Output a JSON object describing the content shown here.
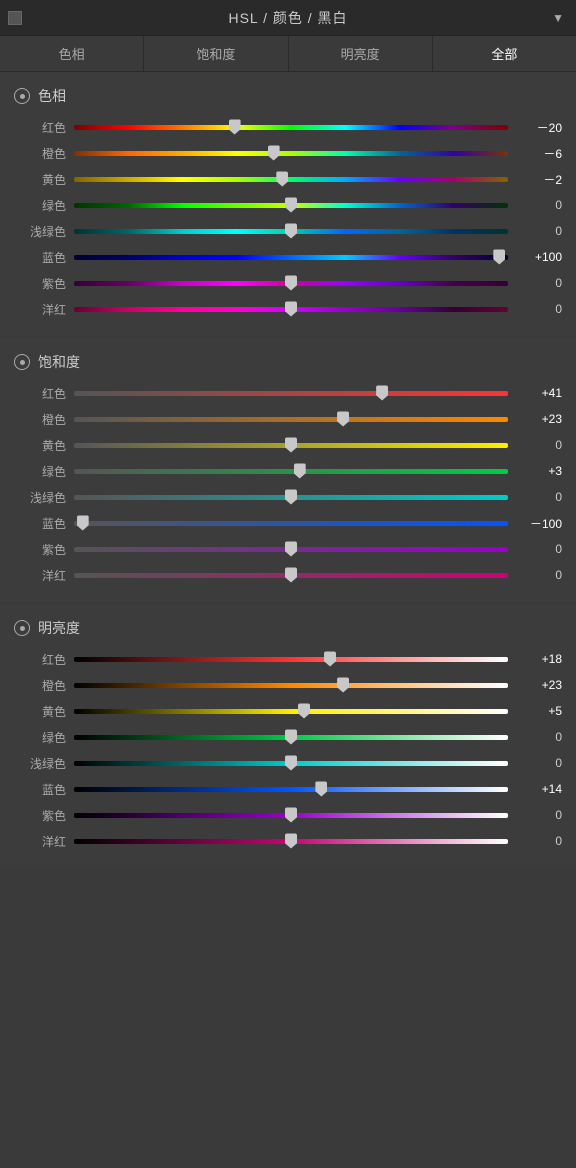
{
  "titleBar": {
    "title": "HSL / 颜色 / 黑白",
    "arrowLabel": "▼"
  },
  "tabs": [
    {
      "id": "hue",
      "label": "色相",
      "active": false
    },
    {
      "id": "saturation",
      "label": "饱和度",
      "active": false
    },
    {
      "id": "luminance",
      "label": "明亮度",
      "active": false
    },
    {
      "id": "all",
      "label": "全部",
      "active": true
    }
  ],
  "sections": [
    {
      "id": "hue",
      "title": "色相",
      "sliders": [
        {
          "label": "红色",
          "gradient": "hue-red",
          "value": -20,
          "displayValue": "－20",
          "thumbPct": 37
        },
        {
          "label": "橙色",
          "gradient": "hue-orange",
          "value": -6,
          "displayValue": "－6",
          "thumbPct": 46
        },
        {
          "label": "黄色",
          "gradient": "hue-yellow",
          "value": -2,
          "displayValue": "－2",
          "thumbPct": 48
        },
        {
          "label": "绿色",
          "gradient": "hue-green",
          "value": 0,
          "displayValue": "0",
          "thumbPct": 50
        },
        {
          "label": "浅绿色",
          "gradient": "hue-aqua",
          "value": 0,
          "displayValue": "0",
          "thumbPct": 50
        },
        {
          "label": "蓝色",
          "gradient": "hue-blue",
          "value": 100,
          "displayValue": "+100",
          "thumbPct": 98
        },
        {
          "label": "紫色",
          "gradient": "hue-purple",
          "value": 0,
          "displayValue": "0",
          "thumbPct": 50
        },
        {
          "label": "洋红",
          "gradient": "hue-magenta",
          "value": 0,
          "displayValue": "0",
          "thumbPct": 50
        }
      ]
    },
    {
      "id": "saturation",
      "title": "饱和度",
      "sliders": [
        {
          "label": "红色",
          "gradient": "sat-red",
          "value": 41,
          "displayValue": "+41",
          "thumbPct": 71
        },
        {
          "label": "橙色",
          "gradient": "sat-orange",
          "value": 23,
          "displayValue": "+23",
          "thumbPct": 62
        },
        {
          "label": "黄色",
          "gradient": "sat-yellow",
          "value": 0,
          "displayValue": "0",
          "thumbPct": 50
        },
        {
          "label": "绿色",
          "gradient": "sat-green",
          "value": 3,
          "displayValue": "+3",
          "thumbPct": 52
        },
        {
          "label": "浅绿色",
          "gradient": "sat-aqua",
          "value": 0,
          "displayValue": "0",
          "thumbPct": 50
        },
        {
          "label": "蓝色",
          "gradient": "sat-blue",
          "value": -100,
          "displayValue": "－100",
          "thumbPct": 2
        },
        {
          "label": "紫色",
          "gradient": "sat-purple",
          "value": 0,
          "displayValue": "0",
          "thumbPct": 50
        },
        {
          "label": "洋红",
          "gradient": "sat-magenta",
          "value": 0,
          "displayValue": "0",
          "thumbPct": 50
        }
      ]
    },
    {
      "id": "luminance",
      "title": "明亮度",
      "sliders": [
        {
          "label": "红色",
          "gradient": "lum-red",
          "value": 18,
          "displayValue": "+18",
          "thumbPct": 59
        },
        {
          "label": "橙色",
          "gradient": "lum-orange",
          "value": 23,
          "displayValue": "+23",
          "thumbPct": 62
        },
        {
          "label": "黄色",
          "gradient": "lum-yellow",
          "value": 5,
          "displayValue": "+5",
          "thumbPct": 53
        },
        {
          "label": "绿色",
          "gradient": "lum-green",
          "value": 0,
          "displayValue": "0",
          "thumbPct": 50
        },
        {
          "label": "浅绿色",
          "gradient": "lum-aqua",
          "value": 0,
          "displayValue": "0",
          "thumbPct": 50
        },
        {
          "label": "蓝色",
          "gradient": "lum-blue",
          "value": 14,
          "displayValue": "+14",
          "thumbPct": 57
        },
        {
          "label": "紫色",
          "gradient": "lum-purple",
          "value": 0,
          "displayValue": "0",
          "thumbPct": 50
        },
        {
          "label": "洋红",
          "gradient": "lum-magenta",
          "value": 0,
          "displayValue": "0",
          "thumbPct": 50
        }
      ]
    }
  ]
}
